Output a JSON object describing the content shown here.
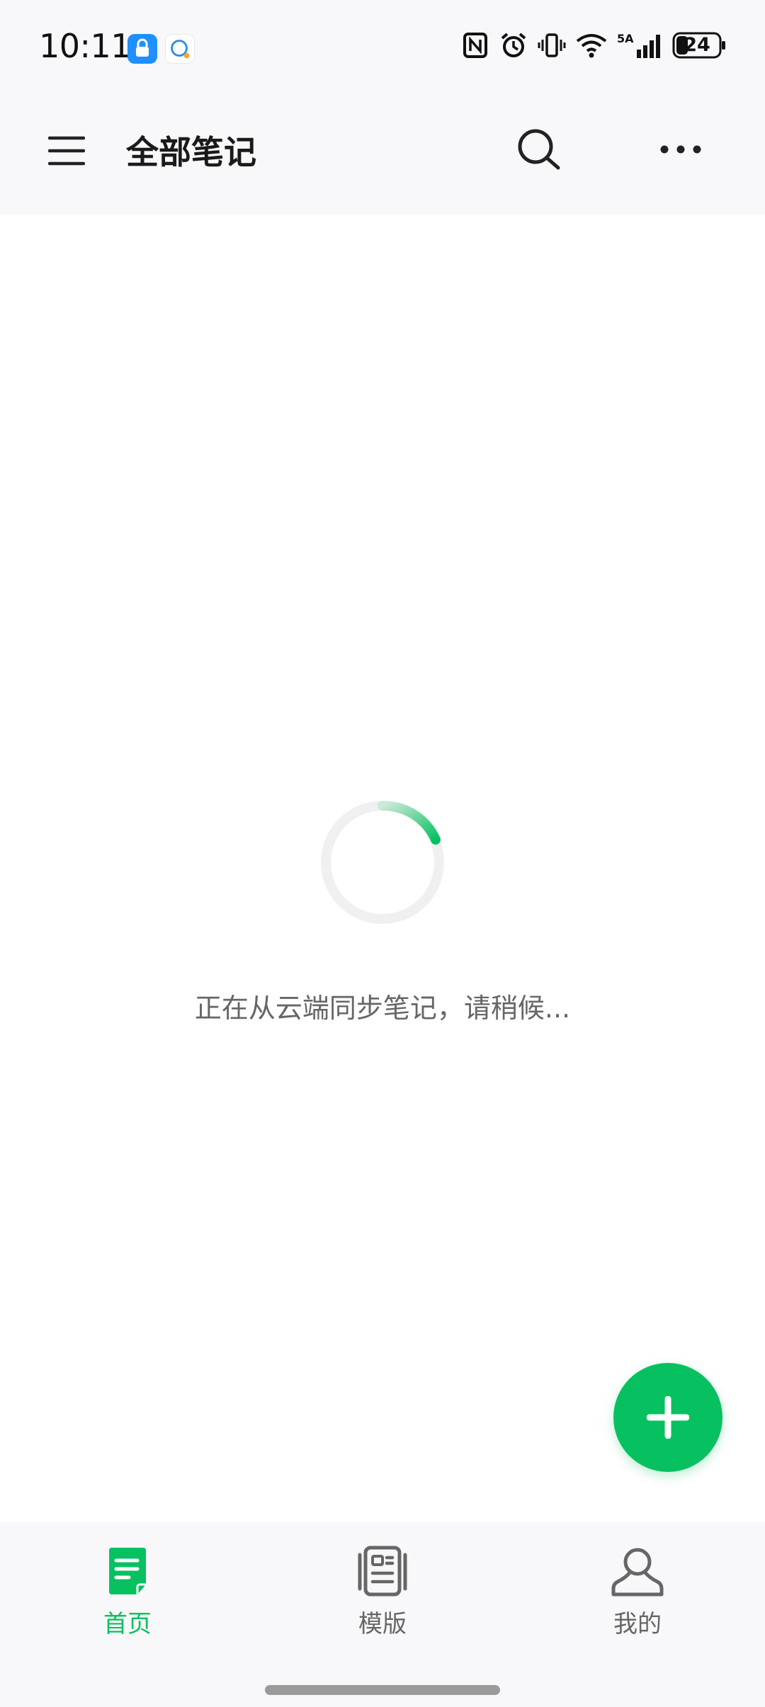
{
  "status_bar": {
    "time": "10:11",
    "battery": "24",
    "network_label": "5A"
  },
  "header": {
    "title": "全部笔记"
  },
  "loading": {
    "message": "正在从云端同步笔记，请稍候..."
  },
  "bottom_nav": {
    "items": [
      {
        "label": "首页",
        "active": true
      },
      {
        "label": "模版",
        "active": false
      },
      {
        "label": "我的",
        "active": false
      }
    ]
  },
  "colors": {
    "accent": "#07c160",
    "nav_inactive": "#666666",
    "bar_background": "#f8f8fa"
  }
}
